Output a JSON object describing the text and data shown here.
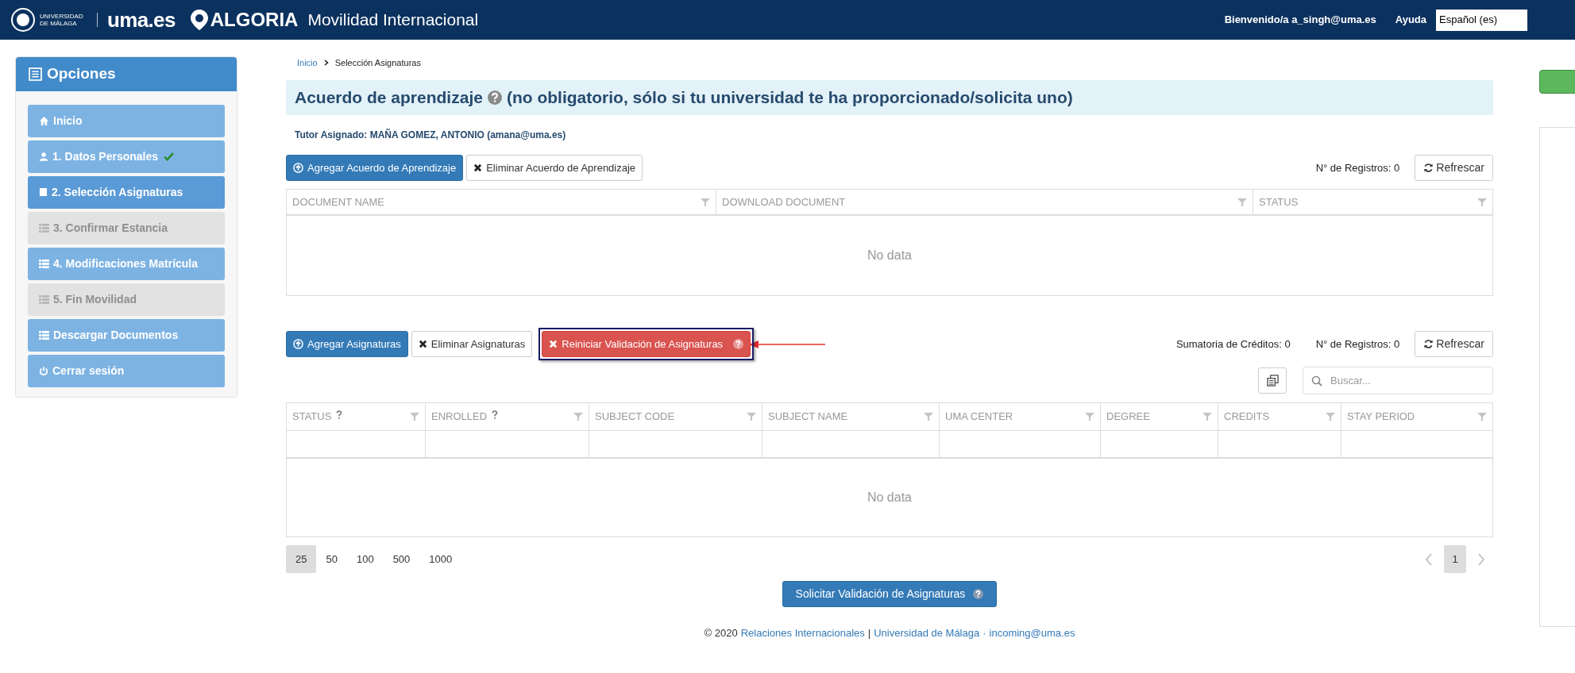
{
  "header": {
    "university_label": "UNIVERSIDAD DE MÁLAGA",
    "site": "uma.es",
    "brand": "ALGORIA",
    "app_title": "Movilidad Internacional",
    "welcome": "Bienvenido/a a_singh@uma.es",
    "help": "Ayuda",
    "language": "Español (es)"
  },
  "sidebar": {
    "title": "Opciones",
    "items": [
      {
        "label": "Inicio",
        "kind": "home",
        "selected": false,
        "disabled": false,
        "checked": false
      },
      {
        "label": "1. Datos Personales",
        "kind": "user",
        "selected": false,
        "disabled": false,
        "checked": true
      },
      {
        "label": "2. Selección Asignaturas",
        "kind": "book",
        "selected": true,
        "disabled": false,
        "checked": false
      },
      {
        "label": "3. Confirmar Estancia",
        "kind": "list",
        "selected": false,
        "disabled": true,
        "checked": false
      },
      {
        "label": "4. Modificaciones Matrícula",
        "kind": "list",
        "selected": false,
        "disabled": false,
        "checked": false
      },
      {
        "label": "5. Fin Movilidad",
        "kind": "list",
        "selected": false,
        "disabled": true,
        "checked": false
      },
      {
        "label": "Descargar Documentos",
        "kind": "list",
        "selected": false,
        "disabled": false,
        "checked": false
      },
      {
        "label": "Cerrar sesión",
        "kind": "power",
        "selected": false,
        "disabled": false,
        "checked": false
      }
    ]
  },
  "breadcrumb": [
    "Inicio",
    "Selección Asignaturas"
  ],
  "page_title": {
    "title": "Acuerdo de aprendizaje",
    "note": "(no obligatorio, sólo si tu universidad te ha proporcionado/solicita uno)"
  },
  "tutor": "Tutor Asignado: MAÑA GOMEZ, ANTONIO (amana@uma.es)",
  "agreements": {
    "buttons": [
      {
        "label": "Agregar Acuerdo de Aprendizaje",
        "kind": "primary"
      },
      {
        "label": "Eliminar Acuerdo de Aprendizaje",
        "kind": "delete"
      }
    ],
    "records": "N° de Registros: 0",
    "refresh": "Refrescar",
    "columns": [
      "DOCUMENT NAME",
      "DOWNLOAD DOCUMENT",
      "STATUS"
    ],
    "empty": "No data"
  },
  "subjects": {
    "buttons": [
      {
        "label": "Agregar Asignaturas",
        "kind": "primary"
      },
      {
        "label": "Eliminar Asignaturas",
        "kind": "delete"
      },
      {
        "label": "Reiniciar Validación de Asignaturas",
        "kind": "danger"
      }
    ],
    "credits": "Sumatoria de Créditos: 0",
    "records": "N° de Registros: 0",
    "refresh": "Refrescar",
    "search_placeholder": "Buscar...",
    "columns": [
      {
        "label": "STATUS",
        "help": true
      },
      {
        "label": "ENROLLED",
        "help": true
      },
      {
        "label": "SUBJECT CODE",
        "help": false
      },
      {
        "label": "SUBJECT NAME",
        "help": false
      },
      {
        "label": "UMA CENTER",
        "help": false
      },
      {
        "label": "DEGREE",
        "help": false
      },
      {
        "label": "CREDITS",
        "help": false
      },
      {
        "label": "STAY PERIOD",
        "help": false
      }
    ],
    "empty": "No data",
    "page_sizes": [
      {
        "label": "25",
        "selected": true
      },
      {
        "label": "50",
        "selected": false
      },
      {
        "label": "100",
        "selected": false
      },
      {
        "label": "500",
        "selected": false
      },
      {
        "label": "1000",
        "selected": false
      }
    ],
    "pages": [
      {
        "label": "1",
        "selected": true
      }
    ]
  },
  "submit": "Solicitar Validación de Asignaturas",
  "footer": {
    "copyright": "© 2020",
    "links": [
      "Relaciones Internacionales",
      "Universidad de Málaga",
      "incoming@uma.es"
    ],
    "separators": [
      "|",
      "·"
    ]
  }
}
